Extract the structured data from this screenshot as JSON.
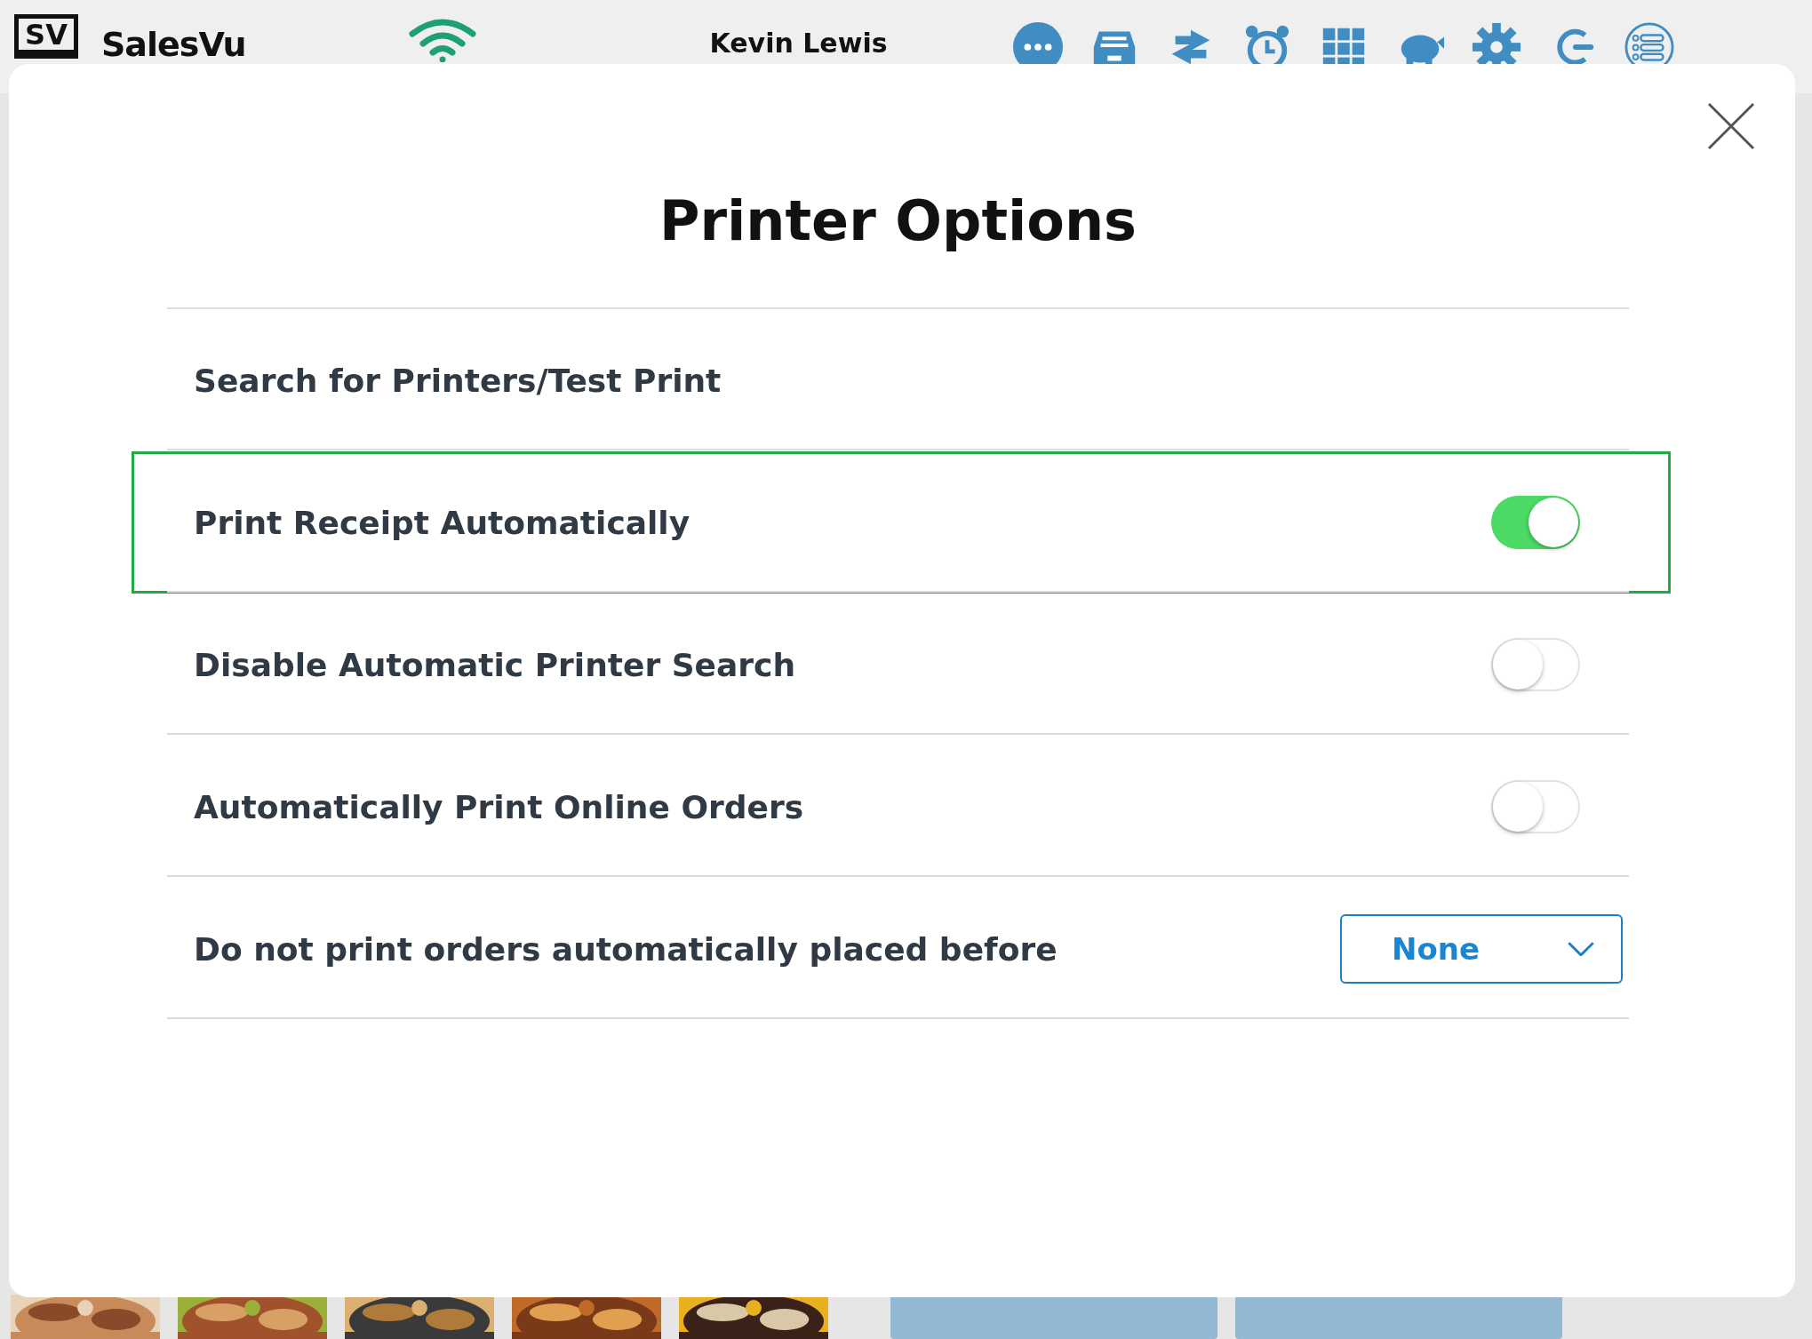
{
  "top_bar": {
    "logo_text": "SV",
    "app_name": "SalesVu",
    "user": "Kevin Lewis"
  },
  "dialog": {
    "title": "Printer Options",
    "rows": [
      {
        "kind": "link",
        "label": "Search for Printers/Test Print",
        "highlighted": false
      },
      {
        "kind": "toggle",
        "label": "Print Receipt Automatically",
        "on": true,
        "highlighted": true
      },
      {
        "kind": "toggle",
        "label": "Disable Automatic Printer Search",
        "on": false,
        "highlighted": false
      },
      {
        "kind": "toggle",
        "label": "Automatically Print Online Orders",
        "on": false,
        "highlighted": false
      },
      {
        "kind": "dropdown",
        "label": "Do not print orders automatically placed before",
        "value": "None",
        "highlighted": false
      }
    ]
  }
}
